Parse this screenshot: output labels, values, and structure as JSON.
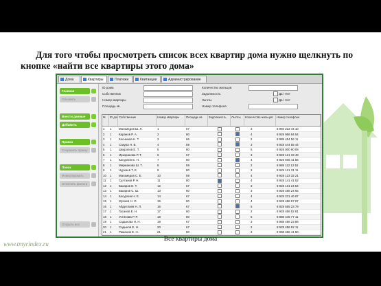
{
  "heading": {
    "line": "Для того чтобы просмотреть список всех квартир дома нужно щелкнуть по кнопке «найти все квартиры этого дома»"
  },
  "caption": "Все квартиры дома",
  "watermark": "www.tmyrindex.ru",
  "tabs": [
    {
      "label": "Дома"
    },
    {
      "label": "Квартиры"
    },
    {
      "label": "Платежи"
    },
    {
      "label": "Квитанции"
    },
    {
      "label": "Администрирование"
    }
  ],
  "sidebar": {
    "buttons": [
      {
        "label": "Главная",
        "state": "green"
      },
      {
        "label": "Обновить",
        "state": "gray"
      },
      {
        "label": "Внести данные",
        "state": "green"
      },
      {
        "label": "Добавить",
        "state": "green"
      },
      {
        "label": "Правка",
        "state": "green"
      },
      {
        "label": "Сохранить правку",
        "state": "gray"
      },
      {
        "label": "Поиск",
        "state": "green"
      },
      {
        "label": "Инвертировать",
        "state": "gray"
      },
      {
        "label": "Отменить фильтр",
        "state": "gray"
      },
      {
        "label": "Открыть все",
        "state": "gray"
      }
    ]
  },
  "form": {
    "left_labels": [
      "ID дома",
      "Собственник",
      "Номер квартиры",
      "Площадь кв."
    ],
    "right_labels": [
      "Количество жильцов",
      "Задолжность",
      "Льготы",
      "Номер телефона"
    ],
    "checkbox_label_1": "Да / Нет",
    "checkbox_label_2": "Да / Нет"
  },
  "grid": {
    "columns": [
      "M",
      "ID дома",
      "Собственник",
      "Номер квартиры",
      "Площадь кв.",
      "Задолжность",
      "Льготы",
      "Количество жильцов",
      "Номер телефона"
    ],
    "rows": [
      {
        "m": "1",
        "id": "1",
        "owner": "Магомедов Ш. Л.",
        "apt": "1",
        "area": "67",
        "debt": false,
        "lgota": false,
        "res": "3",
        "phone": "8 960 222 44 10"
      },
      {
        "m": "2",
        "id": "1",
        "owner": "Каранов Р. А.",
        "apt": "2",
        "area": "80",
        "debt": false,
        "lgota": true,
        "res": "4",
        "phone": "8 928 956 94 54"
      },
      {
        "m": "3",
        "id": "1",
        "owner": "Касимова Н. Т.",
        "apt": "3",
        "area": "66",
        "debt": false,
        "lgota": false,
        "res": "2",
        "phone": "8 988 454 56 11"
      },
      {
        "m": "4",
        "id": "1",
        "owner": "Сакура Н. В.",
        "apt": "4",
        "area": "59",
        "debt": false,
        "lgota": true,
        "res": "3",
        "phone": "8 928 444 55 44"
      },
      {
        "m": "5",
        "id": "1",
        "owner": "Шкуропов Е. Т.",
        "apt": "5",
        "area": "80",
        "debt": false,
        "lgota": false,
        "res": "5",
        "phone": "8 928 000 90 09"
      },
      {
        "m": "6",
        "id": "1",
        "owner": "Иркоранова Р. Т.",
        "apt": "6",
        "area": "67",
        "debt": false,
        "lgota": false,
        "res": "3",
        "phone": "8 928 121 33 49"
      },
      {
        "m": "7",
        "id": "1",
        "owner": "Касурлин Е. Н.",
        "apt": "7",
        "area": "80",
        "debt": false,
        "lgota": true,
        "res": "4",
        "phone": "8 929 505 41 56"
      },
      {
        "m": "8",
        "id": "1",
        "owner": "Мирманова Ш. Т.",
        "apt": "8",
        "area": "59",
        "debt": false,
        "lgota": false,
        "res": "2",
        "phone": "8 988 112 12 52"
      },
      {
        "m": "9",
        "id": "1",
        "owner": "Нурхаев Т. Е.",
        "apt": "9",
        "area": "80",
        "debt": false,
        "lgota": false,
        "res": "3",
        "phone": "8 928 121 31 11"
      },
      {
        "m": "10",
        "id": "1",
        "owner": "Магомедов С. Е.",
        "apt": "10",
        "area": "59",
        "debt": false,
        "lgota": false,
        "res": "4",
        "phone": "8 928 123 32 21"
      },
      {
        "m": "11",
        "id": "1",
        "owner": "Султанов Р. Н.",
        "apt": "11",
        "area": "80",
        "debt": true,
        "lgota": false,
        "res": "4",
        "phone": "8 928 141 41 52"
      },
      {
        "m": "12",
        "id": "1",
        "owner": "Бакаров Е. Т.",
        "apt": "12",
        "area": "67",
        "debt": false,
        "lgota": false,
        "res": "3",
        "phone": "8 928 131 24 54"
      },
      {
        "m": "13",
        "id": "1",
        "owner": "Бакаров С. Ш.",
        "apt": "13",
        "area": "80",
        "debt": false,
        "lgota": false,
        "res": "3",
        "phone": "8 928 456 24 55"
      },
      {
        "m": "14",
        "id": "1",
        "owner": "Касурлин Н. Е.",
        "apt": "14",
        "area": "67",
        "debt": false,
        "lgota": false,
        "res": "4",
        "phone": "8 928 231 46 87"
      },
      {
        "m": "15",
        "id": "1",
        "owner": "Мусаев Н. О.",
        "apt": "15",
        "area": "80",
        "debt": false,
        "lgota": false,
        "res": "4",
        "phone": "8 928 458 97 87"
      },
      {
        "m": "16",
        "id": "1",
        "owner": "Абдуллаев Н. Л.",
        "apt": "16",
        "area": "67",
        "debt": false,
        "lgota": true,
        "res": "5",
        "phone": "8 928 555 23 79"
      },
      {
        "m": "17",
        "id": "1",
        "owner": "Гасанов Е. Н.",
        "apt": "17",
        "area": "80",
        "debt": false,
        "lgota": false,
        "res": "2",
        "phone": "8 928 456 52 81"
      },
      {
        "m": "18",
        "id": "1",
        "owner": "Устинова Р. Р.",
        "apt": "18",
        "area": "80",
        "debt": false,
        "lgota": false,
        "res": "5",
        "phone": "8 988 445 77 11"
      },
      {
        "m": "19",
        "id": "1",
        "owner": "Садыкова Н. Н.",
        "apt": "19",
        "area": "67",
        "debt": false,
        "lgota": false,
        "res": "3",
        "phone": "8 988 456 23 89"
      },
      {
        "m": "20",
        "id": "1",
        "owner": "Садыков Е. Н.",
        "apt": "20",
        "area": "67",
        "debt": false,
        "lgota": false,
        "res": "2",
        "phone": "8 928 456 52 11"
      },
      {
        "m": "21",
        "id": "1",
        "owner": "Раманов Е. Н.",
        "apt": "21",
        "area": "80",
        "debt": false,
        "lgota": false,
        "res": "3",
        "phone": "8 988 456 41 50"
      }
    ]
  },
  "colors": {
    "accent_green": "#6cbf29",
    "frame_green": "#2e7d32",
    "tab_blue": "#3a7bd5"
  }
}
